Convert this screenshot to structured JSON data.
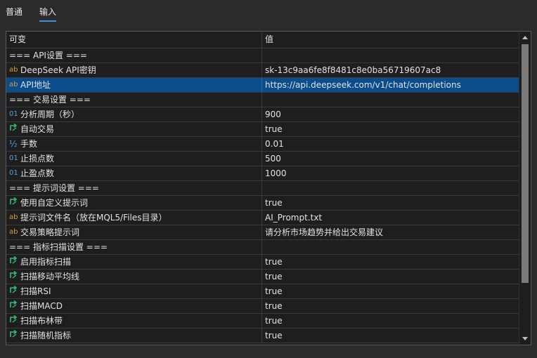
{
  "tabs": [
    {
      "label": "普通"
    },
    {
      "label": "输入"
    }
  ],
  "columns": {
    "name": "可变",
    "value": "值"
  },
  "rows": [
    {
      "icon": "",
      "name": "=== API设置 ===",
      "value": ""
    },
    {
      "icon": "ab",
      "name": "DeepSeek API密钥",
      "value": "sk-13c9aa6fe8f8481c8e0ba56719607ac8"
    },
    {
      "icon": "ab",
      "name": "API地址",
      "value": "https://api.deepseek.com/v1/chat/completions",
      "selected": true
    },
    {
      "icon": "",
      "name": "=== 交易设置 ===",
      "value": ""
    },
    {
      "icon": "01",
      "name": "分析周期（秒）",
      "value": "900"
    },
    {
      "icon": "bool",
      "name": "自动交易",
      "value": "true"
    },
    {
      "icon": "½",
      "name": "手数",
      "value": "0.01"
    },
    {
      "icon": "01",
      "name": "止损点数",
      "value": "500"
    },
    {
      "icon": "01",
      "name": "止盈点数",
      "value": "1000"
    },
    {
      "icon": "",
      "name": "=== 提示词设置 ===",
      "value": ""
    },
    {
      "icon": "bool",
      "name": "使用自定义提示词",
      "value": "true"
    },
    {
      "icon": "ab",
      "name": "提示词文件名（放在MQL5/Files目录）",
      "value": "AI_Prompt.txt"
    },
    {
      "icon": "ab",
      "name": "交易策略提示词",
      "value": "请分析市场趋势并给出交易建议"
    },
    {
      "icon": "",
      "name": "=== 指标扫描设置 ===",
      "value": ""
    },
    {
      "icon": "bool",
      "name": "启用指标扫描",
      "value": "true"
    },
    {
      "icon": "bool",
      "name": "扫描移动平均线",
      "value": "true"
    },
    {
      "icon": "bool",
      "name": "扫描RSI",
      "value": "true"
    },
    {
      "icon": "bool",
      "name": "扫描MACD",
      "value": "true"
    },
    {
      "icon": "bool",
      "name": "扫描布林带",
      "value": "true"
    },
    {
      "icon": "bool",
      "name": "扫描随机指标",
      "value": "true"
    }
  ]
}
